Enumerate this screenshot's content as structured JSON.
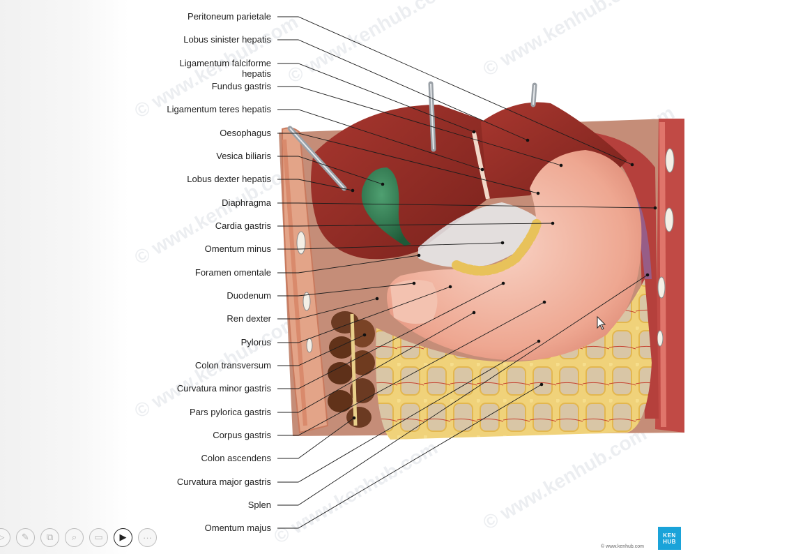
{
  "labels": [
    {
      "text": "Peritoneum parietale"
    },
    {
      "text": "Lobus sinister hepatis"
    },
    {
      "text": "Ligamentum falciforme",
      "text2": "hepatis"
    },
    {
      "text": "Fundus gastris"
    },
    {
      "text": "Ligamentum teres hepatis"
    },
    {
      "text": "Oesophagus"
    },
    {
      "text": "Vesica biliaris"
    },
    {
      "text": "Lobus dexter hepatis"
    },
    {
      "text": "Diaphragma"
    },
    {
      "text": "Cardia gastris"
    },
    {
      "text": "Omentum minus"
    },
    {
      "text": "Foramen omentale"
    },
    {
      "text": "Duodenum"
    },
    {
      "text": "Ren dexter"
    },
    {
      "text": "Pylorus"
    },
    {
      "text": "Colon transversum"
    },
    {
      "text": "Curvatura minor gastris"
    },
    {
      "text": "Pars pylorica gastris"
    },
    {
      "text": "Corpus gastris"
    },
    {
      "text": "Colon ascendens"
    },
    {
      "text": "Curvatura major gastris"
    },
    {
      "text": "Splen"
    },
    {
      "text": "Omentum majus"
    }
  ],
  "watermark": "© www.kenhub.com",
  "logo": {
    "line1": "KEN",
    "line2": "HUB"
  },
  "copyright": "© www.kenhub.com",
  "toolbar": [
    {
      "icon": "play-icon",
      "glyph": "▷"
    },
    {
      "icon": "pen-icon",
      "glyph": "✎"
    },
    {
      "icon": "copy-icon",
      "glyph": "⧉"
    },
    {
      "icon": "search-icon",
      "glyph": "⌕"
    },
    {
      "icon": "keyboard-icon",
      "glyph": "▭"
    },
    {
      "icon": "video-icon",
      "glyph": "▶"
    },
    {
      "icon": "more-icon",
      "glyph": "···"
    }
  ],
  "colors": {
    "liver": "#8e2b24",
    "stomach": "#f1b6a2",
    "gallbladder": "#2d7a4f",
    "fat": "#f0d27a",
    "diaphragm": "#c85e58",
    "colon": "#6b3a22",
    "logo": "#1aa3d9"
  }
}
